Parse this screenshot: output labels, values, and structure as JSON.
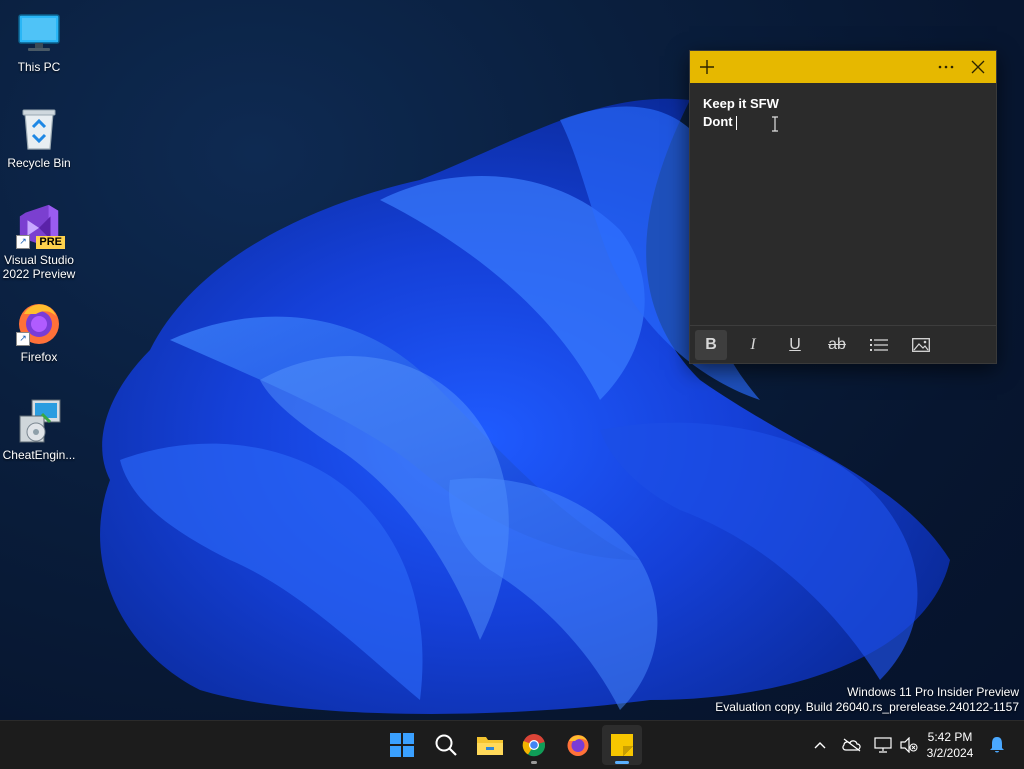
{
  "desktop": {
    "icons": [
      {
        "label": "This PC",
        "icon": "monitor-icon"
      },
      {
        "label": "Recycle Bin",
        "icon": "recycle-bin-icon"
      },
      {
        "label": "Visual Studio 2022 Preview",
        "icon": "visual-studio-icon",
        "badge": "PRE"
      },
      {
        "label": "Firefox",
        "icon": "firefox-icon"
      },
      {
        "label": "CheatEngin...",
        "icon": "installer-icon"
      }
    ]
  },
  "sticky_note": {
    "line1": "Keep it SFW",
    "line2": "Dont",
    "accent": "#e6b800",
    "toolbar": [
      "bold",
      "italic",
      "underline",
      "strikethrough",
      "bullets",
      "image"
    ],
    "bold_glyph": "B",
    "italic_glyph": "I",
    "underline_glyph": "U",
    "strike_glyph": "ab"
  },
  "watermark": {
    "line1": "Windows 11 Pro Insider Preview",
    "line2": "Evaluation copy. Build 26040.rs_prerelease.240122-1157"
  },
  "taskbar": {
    "apps": [
      "start",
      "search",
      "file-explorer",
      "chrome",
      "firefox",
      "sticky-notes"
    ],
    "time": "5:42 PM",
    "date": "3/2/2024"
  }
}
